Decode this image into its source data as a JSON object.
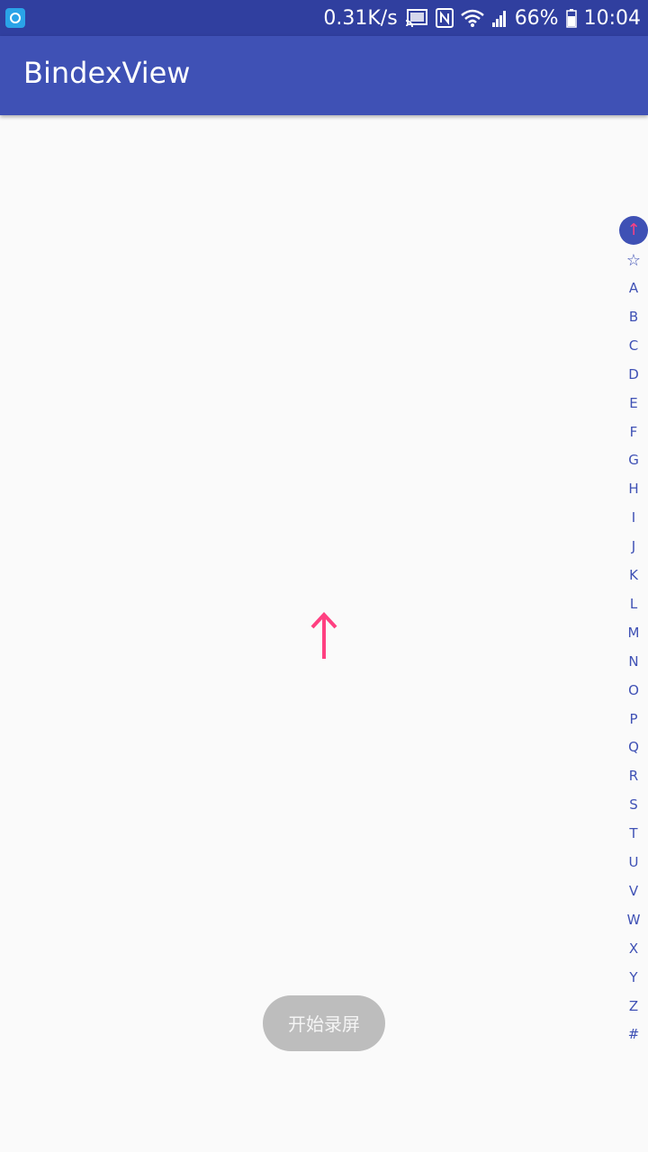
{
  "status_bar": {
    "net_speed": "0.31K/s",
    "battery": "66%",
    "time": "10:04",
    "icons": [
      "app-icon",
      "cast-icon",
      "nfc-icon",
      "wifi-icon",
      "signal-icon",
      "battery-icon"
    ]
  },
  "app_bar": {
    "title": "BindexView",
    "color": "#3f51b5"
  },
  "center_indicator": {
    "symbol": "↑",
    "color": "#ff4081"
  },
  "index_bar": {
    "selected": "↑",
    "items": [
      "↑",
      "☆",
      "A",
      "B",
      "C",
      "D",
      "E",
      "F",
      "G",
      "H",
      "I",
      "J",
      "K",
      "L",
      "M",
      "N",
      "O",
      "P",
      "Q",
      "R",
      "S",
      "T",
      "U",
      "V",
      "W",
      "X",
      "Y",
      "Z",
      "#"
    ]
  },
  "record_button": {
    "label": "开始录屏"
  }
}
